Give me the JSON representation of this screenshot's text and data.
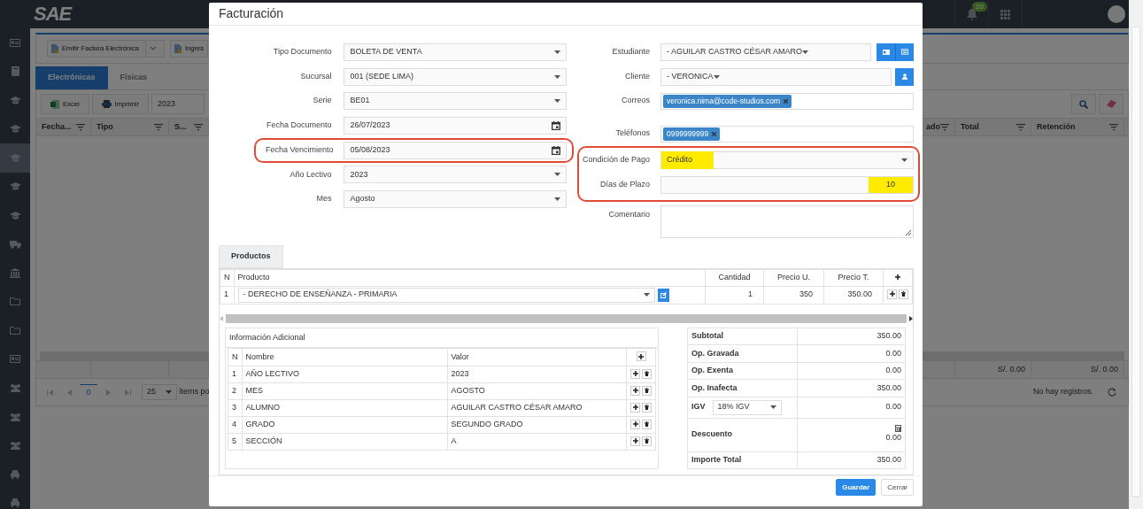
{
  "topbar": {
    "logo": "SAE",
    "notifications": "20"
  },
  "sidebar": {
    "items": [
      {
        "kind": "card",
        "selected": false
      },
      {
        "kind": "book",
        "selected": false
      },
      {
        "kind": "cap",
        "selected": false
      },
      {
        "kind": "cap",
        "selected": false
      },
      {
        "kind": "cap",
        "selected": true
      },
      {
        "kind": "cap",
        "selected": false
      },
      {
        "kind": "cap",
        "selected": false
      },
      {
        "kind": "truck",
        "selected": false
      },
      {
        "kind": "bank",
        "selected": false
      },
      {
        "kind": "folder",
        "selected": false
      },
      {
        "kind": "folder",
        "selected": false
      },
      {
        "kind": "card",
        "selected": false
      },
      {
        "kind": "people",
        "selected": false
      },
      {
        "kind": "people",
        "selected": false
      },
      {
        "kind": "people",
        "selected": false
      },
      {
        "kind": "car",
        "selected": false
      },
      {
        "kind": "car",
        "selected": false
      }
    ]
  },
  "toolbar": {
    "buttons": [
      {
        "label": "Emitir Factura Electrónica",
        "kind": "split"
      },
      {
        "label": "Ingres",
        "kind": "plain"
      }
    ]
  },
  "tabs": [
    {
      "label": "Electrónicas",
      "selected": true
    },
    {
      "label": "Físicas",
      "selected": false
    }
  ],
  "grid_toolbar": {
    "buttons": [
      {
        "label": "Excel",
        "kind": "excel"
      },
      {
        "label": "Imprimir",
        "kind": "print"
      }
    ],
    "year": "2023"
  },
  "grid": {
    "columns": [
      "Fecha...",
      "Tipo",
      "S...",
      "ado",
      "Total",
      "Retención"
    ],
    "totals": [
      "S/. 0.00",
      "S/. 0.00"
    ]
  },
  "pager": {
    "page": "0",
    "page_size": "25",
    "items_label": "ítems po",
    "status": "No hay registros."
  },
  "modal": {
    "title": "Facturación",
    "left_fields": [
      {
        "label": "Tipo Documento",
        "value": "BOLETA DE VENTA",
        "kind": "select",
        "highlighted": false
      },
      {
        "label": "Sucursal",
        "value": "001 (SEDE LIMA)",
        "kind": "select",
        "highlighted": false
      },
      {
        "label": "Serie",
        "value": "BE01",
        "kind": "select",
        "highlighted": false
      },
      {
        "label": "Fecha Documento",
        "value": "26/07/2023",
        "kind": "date",
        "highlighted": false
      },
      {
        "label": "Fecha Vencimiento",
        "value": "05/08/2023",
        "kind": "date",
        "highlighted": true
      },
      {
        "label": "Año Lectivo",
        "value": "2023",
        "kind": "select",
        "highlighted": false
      },
      {
        "label": "Mes",
        "value": "Agosto",
        "kind": "select",
        "highlighted": false
      }
    ],
    "right_fields": [
      {
        "label": "Estudiante",
        "value": "- AGUILAR CASTRO CÉSAR AMARO",
        "kind": "student",
        "highlighted": false,
        "marked": false
      },
      {
        "label": "Cliente",
        "value": "- VERONICA",
        "kind": "client",
        "highlighted": false,
        "marked": false
      },
      {
        "label": "Correos",
        "tags": [
          "veronica.nima@code-studios.com"
        ],
        "kind": "tags",
        "highlighted": false
      },
      {
        "label": "Teléfonos",
        "tags": [
          "0999999999"
        ],
        "kind": "tags",
        "highlighted": false
      },
      {
        "label": "Condición de Pago",
        "value": "Crédito",
        "kind": "select",
        "highlighted": true,
        "marked": true
      },
      {
        "label": "Días de Plazo",
        "value": "10",
        "kind": "number",
        "highlighted": true,
        "marked": true
      },
      {
        "label": "Comentario",
        "kind": "textarea",
        "highlighted": false
      }
    ],
    "product_tabs": [
      {
        "label": "Productos",
        "selected": true
      }
    ],
    "products": {
      "columns": [
        "N",
        "Producto",
        "Cantidad",
        "Precio U.",
        "Precio T."
      ],
      "rows": [
        {
          "n": "1",
          "product": "- DERECHO DE ENSEÑANZA - PRIMARIA",
          "quantity": "1",
          "unit_price": "350",
          "total": "350.00"
        }
      ]
    },
    "additional_info": {
      "title": "Información Adicional",
      "columns": [
        "N",
        "Nombre",
        "Valor"
      ],
      "rows": [
        {
          "n": "1",
          "name": "AÑO LECTIVO",
          "value": "2023"
        },
        {
          "n": "2",
          "name": "MES",
          "value": "AGOSTO"
        },
        {
          "n": "3",
          "name": "ALUMNO",
          "value": "AGUILAR CASTRO CÉSAR AMARO"
        },
        {
          "n": "4",
          "name": "GRADO",
          "value": "SEGUNDO GRADO"
        },
        {
          "n": "5",
          "name": "SECCIÓN",
          "value": "A"
        }
      ]
    },
    "totals": [
      {
        "label": "Subtotal",
        "value": "350.00",
        "kind": "plain"
      },
      {
        "label": "Op. Gravada",
        "value": "0.00",
        "kind": "plain"
      },
      {
        "label": "Op. Exenta",
        "value": "0.00",
        "kind": "plain"
      },
      {
        "label": "Op. Inafecta",
        "value": "350.00",
        "kind": "plain"
      },
      {
        "label": "IGV",
        "select": "18% IGV",
        "value": "0.00",
        "kind": "select"
      },
      {
        "label": "Descuento",
        "value": "0.00",
        "kind": "discount"
      },
      {
        "label": "Importe Total",
        "value": "350.00",
        "kind": "plain"
      }
    ],
    "buttons": [
      {
        "label": "Guardar",
        "kind": "primary"
      },
      {
        "label": "Cerrar",
        "kind": "secondary"
      }
    ]
  }
}
